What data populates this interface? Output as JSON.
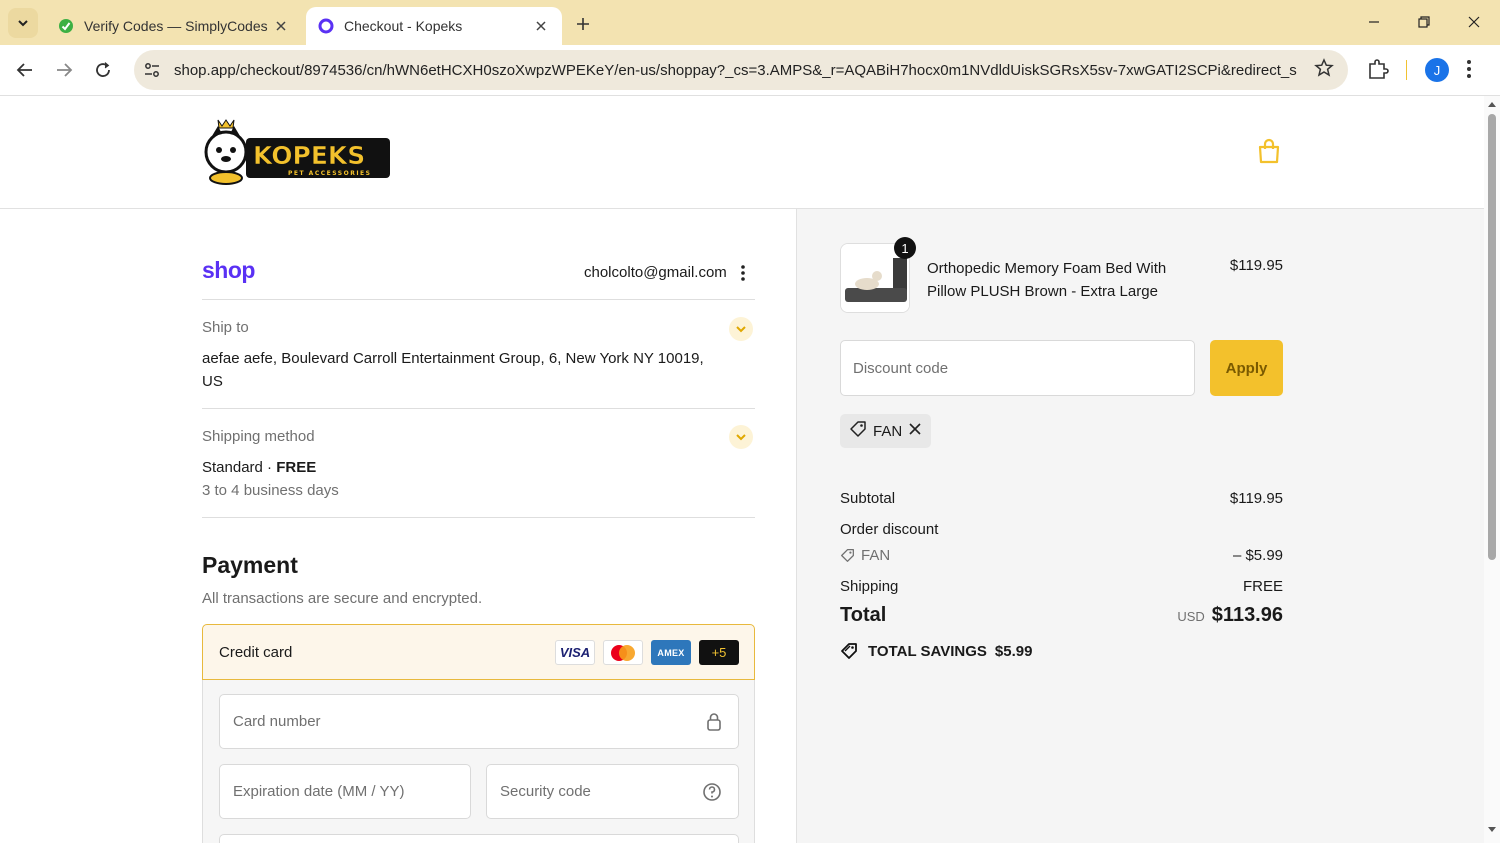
{
  "browser": {
    "tabs": [
      {
        "title": "Verify Codes — SimplyCodes",
        "active": false
      },
      {
        "title": "Checkout - Kopeks",
        "active": true
      }
    ],
    "url": "shop.app/checkout/8974536/cn/hWN6etHCXH0szoXwpzWPEKeY/en-us/shoppay?_cs=3.AMPS&_r=AQABiH7hocx0m1NVdldUiskSGRsX5sv-7xwGATI2SCPi&redirect_s...",
    "profile_initial": "J",
    "accent": "#f3e3b1"
  },
  "site": {
    "logo_text": "KOPEKS",
    "logo_subtext": "PET ACCESSORIES"
  },
  "account": {
    "shop_logo": "shop",
    "email": "cholcolto@gmail.com"
  },
  "ship_to": {
    "label": "Ship to",
    "address_line1": "aefae aefe, Boulevard Carroll Entertainment Group, 6, New York NY 10019,",
    "address_line2": "US"
  },
  "shipping_method": {
    "label": "Shipping method",
    "method": "Standard · ",
    "price": "FREE",
    "eta": "3 to 4 business days"
  },
  "payment": {
    "title": "Payment",
    "subtitle": "All transactions are secure and encrypted.",
    "option_label": "Credit card",
    "cards": [
      "VISA",
      "mastercard",
      "AMEX",
      "+5"
    ],
    "card_number_placeholder": "Card number",
    "expiration_placeholder": "Expiration date (MM / YY)",
    "security_placeholder": "Security code"
  },
  "order": {
    "quantity": "1",
    "product_name": "Orthopedic Memory Foam Bed With Pillow PLUSH Brown - Extra Large",
    "product_price": "$119.95",
    "discount_placeholder": "Discount code",
    "apply_label": "Apply",
    "applied_code": "FAN",
    "subtotal_label": "Subtotal",
    "subtotal_value": "$119.95",
    "order_discount_label": "Order discount",
    "discount_code": "FAN",
    "discount_value": "– $5.99",
    "shipping_label": "Shipping",
    "shipping_value": "FREE",
    "total_label": "Total",
    "total_currency": "USD",
    "total_value": "$113.96",
    "savings_label": "TOTAL SAVINGS",
    "savings_value": "$5.99"
  },
  "colors": {
    "brand_yellow": "#f3c12c",
    "shop_purple": "#5a31f4"
  }
}
